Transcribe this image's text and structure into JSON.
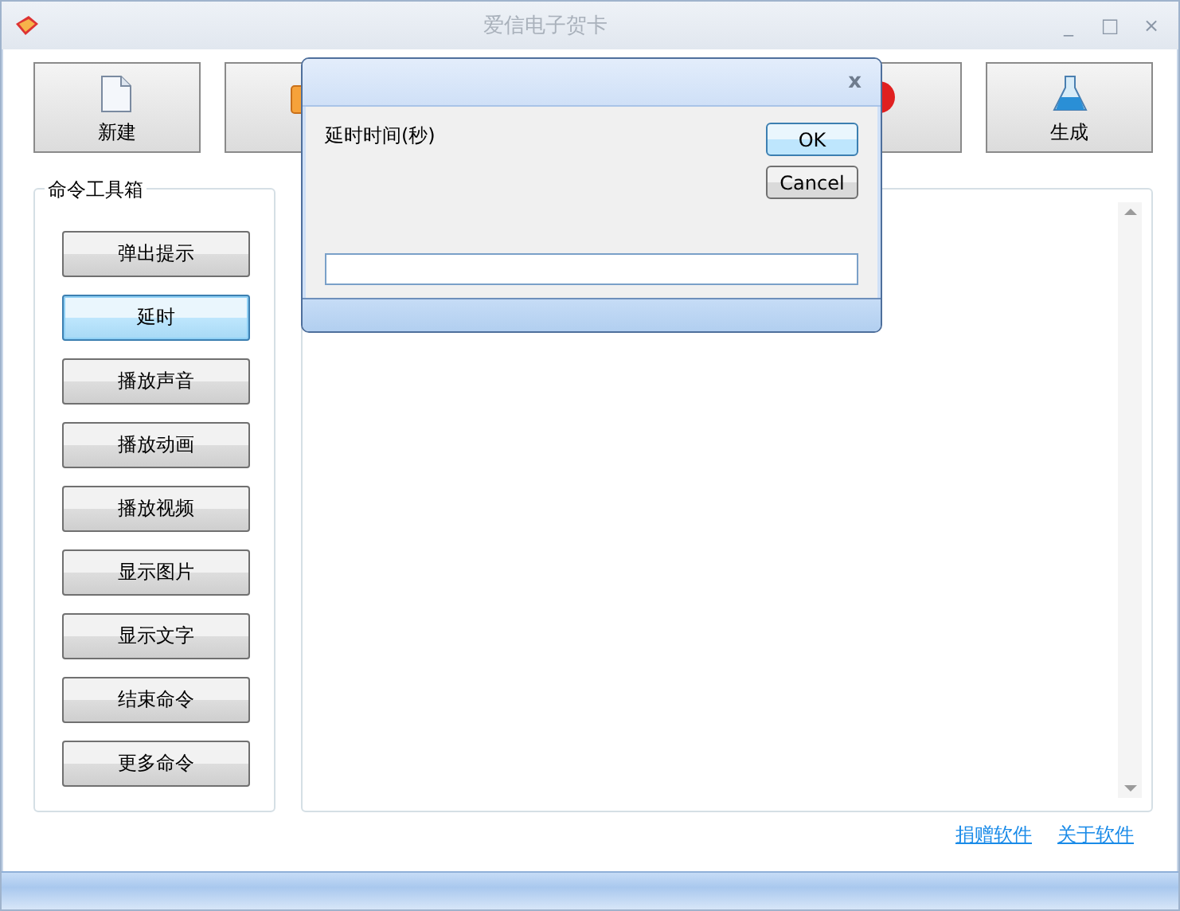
{
  "window": {
    "title": "爱信电子贺卡",
    "controls": [
      "_",
      "□",
      "×"
    ]
  },
  "toolbar": [
    {
      "label": "新建",
      "kind": "document"
    },
    {
      "kind": "folder"
    },
    {
      "kind": "hidden"
    },
    {
      "kind": "hidden"
    },
    {
      "kind": "stop"
    },
    {
      "label": "生成",
      "kind": "flask"
    }
  ],
  "toolbox": {
    "title": "命令工具箱",
    "buttons": [
      {
        "label": "弹出提示",
        "selected": false
      },
      {
        "label": "延时",
        "selected": true
      },
      {
        "label": "播放声音",
        "selected": false
      },
      {
        "label": "播放动画",
        "selected": false
      },
      {
        "label": "播放视频",
        "selected": false
      },
      {
        "label": "显示图片",
        "selected": false
      },
      {
        "label": "显示文字",
        "selected": false
      },
      {
        "label": "结束命令",
        "selected": false
      },
      {
        "label": "更多命令",
        "selected": false
      }
    ]
  },
  "links": [
    "捐赠软件",
    "关于软件"
  ],
  "dialog": {
    "close": "x",
    "prompt": "延时时间(秒)",
    "ok": "OK",
    "cancel": "Cancel"
  }
}
